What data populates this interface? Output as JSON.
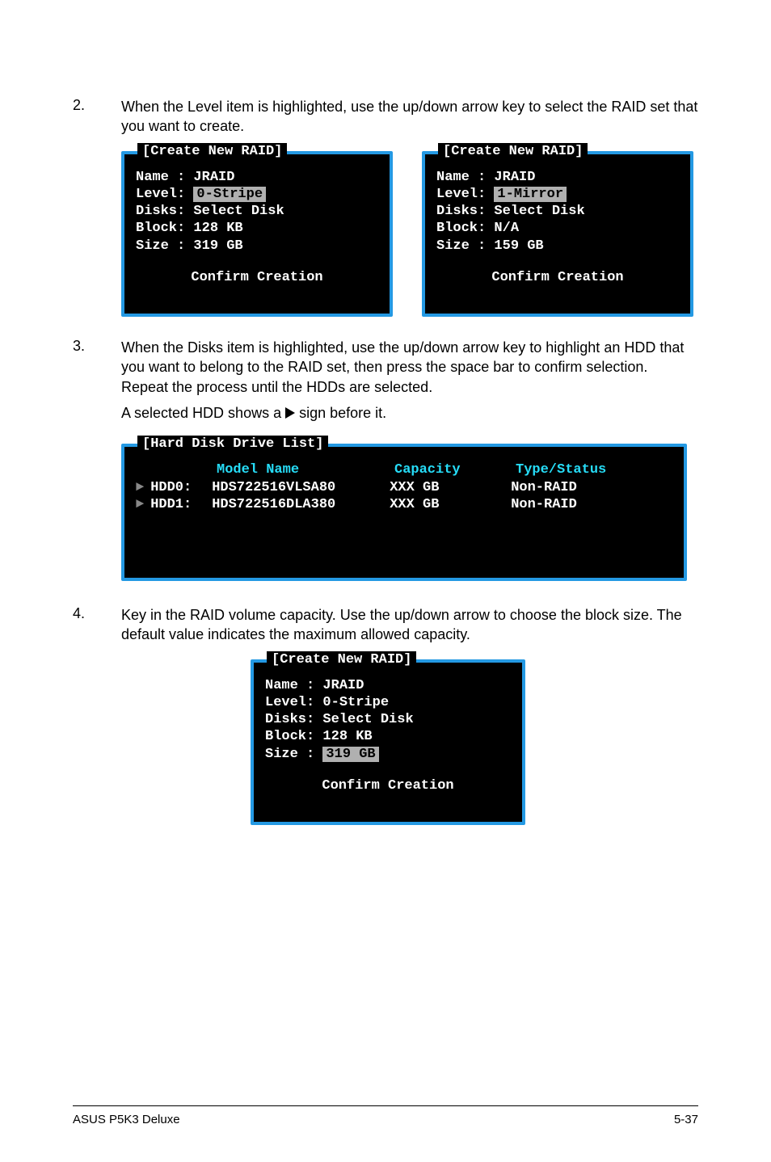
{
  "steps": {
    "s2": {
      "num": "2.",
      "text": "When the Level item is highlighted, use the up/down arrow key to select the RAID set that you want to create."
    },
    "s3": {
      "num": "3.",
      "text1": "When the Disks item is highlighted, use the up/down arrow key to highlight an HDD that you want to belong to the RAID set, then press the space bar to confirm selection. Repeat the process until the HDDs are selected.",
      "text2_pre": "A selected HDD shows a ",
      "text2_post": " sign before it."
    },
    "s4": {
      "num": "4.",
      "text": "Key in the RAID volume capacity. Use the up/down arrow to choose the block size. The default value indicates the maximum allowed capacity."
    }
  },
  "bios_a": {
    "title": "[Create New RAID]",
    "name_label": "Name :",
    "name_value": "JRAID",
    "level_label": "Level:",
    "level_value": "0-Stripe",
    "disks_label": "Disks:",
    "disks_value": "Select Disk",
    "block_label": "Block:",
    "block_value": "128 KB",
    "size_label": "Size :",
    "size_value": "319 GB",
    "confirm": "Confirm Creation"
  },
  "bios_b": {
    "title": "[Create New RAID]",
    "name_label": "Name :",
    "name_value": "JRAID",
    "level_label": "Level:",
    "level_value": "1-Mirror",
    "disks_label": "Disks:",
    "disks_value": "Select Disk",
    "block_label": "Block:",
    "block_value": "N/A",
    "size_label": "Size :",
    "size_value": "159 GB",
    "confirm": "Confirm Creation"
  },
  "disk_list": {
    "title": "[Hard Disk Drive List]",
    "hdr_model": "Model Name",
    "hdr_cap": "Capacity",
    "hdr_type": "Type/Status",
    "rows": [
      {
        "id": "HDD0:",
        "model": "HDS722516VLSA80",
        "cap": "XXX GB",
        "type": "Non-RAID"
      },
      {
        "id": "HDD1:",
        "model": "HDS722516DLA380",
        "cap": "XXX GB",
        "type": "Non-RAID"
      }
    ]
  },
  "bios_c": {
    "title": "[Create New RAID]",
    "name_label": "Name :",
    "name_value": "JRAID",
    "level_label": "Level:",
    "level_value": "0-Stripe",
    "disks_label": "Disks:",
    "disks_value": "Select Disk",
    "block_label": "Block:",
    "block_value": "128 KB",
    "size_label": "Size :",
    "size_value": "319 GB",
    "confirm": "Confirm Creation"
  },
  "footer": {
    "left": "ASUS P5K3 Deluxe",
    "right": "5-37"
  },
  "glyphs": {
    "arrow": "►"
  }
}
